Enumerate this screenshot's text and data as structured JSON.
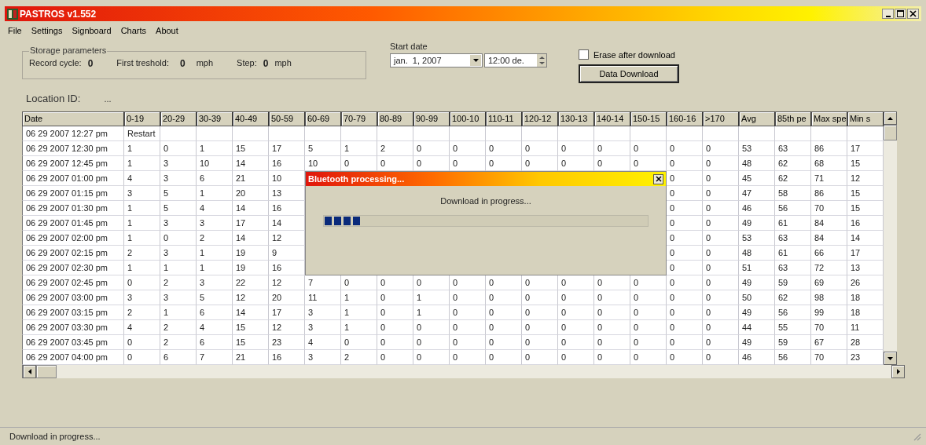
{
  "window": {
    "title": "PASTROS v1.552"
  },
  "menu": [
    "File",
    "Settings",
    "Signboard",
    "Charts",
    "About"
  ],
  "storage": {
    "title": "Storage parameters",
    "fields": [
      {
        "label": "Record cycle:",
        "value": "0"
      },
      {
        "label": "First treshold:",
        "value": "0",
        "unit": "mph"
      },
      {
        "label": "Step:",
        "value": "0",
        "unit": "mph"
      }
    ]
  },
  "start_date": {
    "label": "Start date",
    "date": "jan.  1, 2007",
    "time": "12:00 de."
  },
  "erase": {
    "label": "Erase after download",
    "checked": false
  },
  "download_button": "Data Download",
  "location": {
    "label": "Location ID:",
    "value": "..."
  },
  "table": {
    "columns": [
      "Date",
      "0-19",
      "20-29",
      "30-39",
      "40-49",
      "50-59",
      "60-69",
      "70-79",
      "80-89",
      "90-99",
      "100-10",
      "110-11",
      "120-12",
      "130-13",
      "140-14",
      "150-15",
      "160-16",
      ">170",
      "Avg",
      "85th pe",
      "Max spe",
      "Min s"
    ],
    "rows": [
      {
        "cells": [
          "06 29 2007 12:27 pm",
          "Restart"
        ]
      },
      {
        "cells": [
          "06 29 2007 12:30 pm",
          "1",
          "0",
          "1",
          "15",
          "17",
          "5",
          "1",
          "2",
          "0",
          "0",
          "0",
          "0",
          "0",
          "0",
          "0",
          "0",
          "0",
          "53",
          "63",
          "86",
          "17"
        ]
      },
      {
        "cells": [
          "06 29 2007 12:45 pm",
          "1",
          "3",
          "10",
          "14",
          "16",
          "10",
          "0",
          "0",
          "0",
          "0",
          "0",
          "0",
          "0",
          "0",
          "0",
          "0",
          "0",
          "48",
          "62",
          "68",
          "15"
        ]
      },
      {
        "cells": [
          "06 29 2007 01:00 pm",
          "4",
          "3",
          "6",
          "21",
          "10"
        ],
        "cells_after_dialog": [
          "0",
          "0",
          "45",
          "62",
          "71",
          "12"
        ]
      },
      {
        "cells": [
          "06 29 2007 01:15 pm",
          "3",
          "5",
          "1",
          "20",
          "13"
        ],
        "cells_after_dialog": [
          "0",
          "0",
          "47",
          "58",
          "86",
          "15"
        ]
      },
      {
        "cells": [
          "06 29 2007 01:30 pm",
          "1",
          "5",
          "4",
          "14",
          "16"
        ],
        "cells_after_dialog": [
          "0",
          "0",
          "46",
          "56",
          "70",
          "15"
        ]
      },
      {
        "cells": [
          "06 29 2007 01:45 pm",
          "1",
          "3",
          "3",
          "17",
          "14"
        ],
        "cells_after_dialog": [
          "0",
          "0",
          "49",
          "61",
          "84",
          "16"
        ]
      },
      {
        "cells": [
          "06 29 2007 02:00 pm",
          "1",
          "0",
          "2",
          "14",
          "12"
        ],
        "cells_after_dialog": [
          "0",
          "0",
          "53",
          "63",
          "84",
          "14"
        ]
      },
      {
        "cells": [
          "06 29 2007 02:15 pm",
          "2",
          "3",
          "1",
          "19",
          "9"
        ],
        "cells_after_dialog": [
          "0",
          "0",
          "48",
          "61",
          "66",
          "17"
        ]
      },
      {
        "cells": [
          "06 29 2007 02:30 pm",
          "1",
          "1",
          "1",
          "19",
          "16"
        ],
        "cells_after_dialog": [
          "0",
          "0",
          "51",
          "63",
          "72",
          "13"
        ]
      },
      {
        "cells": [
          "06 29 2007 02:45 pm",
          "0",
          "2",
          "3",
          "22",
          "12",
          "7",
          "0",
          "0",
          "0",
          "0",
          "0",
          "0",
          "0",
          "0",
          "0",
          "0",
          "0",
          "49",
          "59",
          "69",
          "26"
        ]
      },
      {
        "cells": [
          "06 29 2007 03:00 pm",
          "3",
          "3",
          "5",
          "12",
          "20",
          "11",
          "1",
          "0",
          "1",
          "0",
          "0",
          "0",
          "0",
          "0",
          "0",
          "0",
          "0",
          "50",
          "62",
          "98",
          "18"
        ]
      },
      {
        "cells": [
          "06 29 2007 03:15 pm",
          "2",
          "1",
          "6",
          "14",
          "17",
          "3",
          "1",
          "0",
          "1",
          "0",
          "0",
          "0",
          "0",
          "0",
          "0",
          "0",
          "0",
          "49",
          "56",
          "99",
          "18"
        ]
      },
      {
        "cells": [
          "06 29 2007 03:30 pm",
          "4",
          "2",
          "4",
          "15",
          "12",
          "3",
          "1",
          "0",
          "0",
          "0",
          "0",
          "0",
          "0",
          "0",
          "0",
          "0",
          "0",
          "44",
          "55",
          "70",
          "11"
        ]
      },
      {
        "cells": [
          "06 29 2007 03:45 pm",
          "0",
          "2",
          "6",
          "15",
          "23",
          "4",
          "0",
          "0",
          "0",
          "0",
          "0",
          "0",
          "0",
          "0",
          "0",
          "0",
          "0",
          "49",
          "59",
          "67",
          "28"
        ]
      },
      {
        "cells": [
          "06 29 2007 04:00 pm",
          "0",
          "6",
          "7",
          "21",
          "16",
          "3",
          "2",
          "0",
          "0",
          "0",
          "0",
          "0",
          "0",
          "0",
          "0",
          "0",
          "0",
          "46",
          "56",
          "70",
          "23"
        ]
      }
    ]
  },
  "dialog": {
    "title": "Bluetooth processing...",
    "message": "Download in progress...",
    "level": 0.11
  },
  "status_bar": "Download in progress..."
}
